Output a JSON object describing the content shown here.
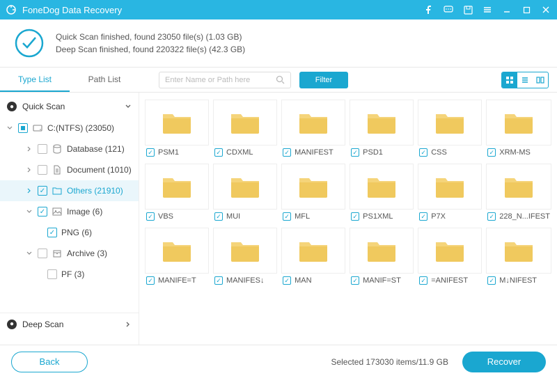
{
  "titlebar": {
    "title": "FoneDog Data Recovery"
  },
  "summary": {
    "line1": "Quick Scan finished, found 23050 file(s) (1.03 GB)",
    "line2": "Deep Scan finished, found 220322 file(s) (42.3 GB)"
  },
  "toolbar": {
    "tab_type": "Type List",
    "tab_path": "Path List",
    "search_placeholder": "Enter Name or Path here",
    "filter_label": "Filter"
  },
  "sidebar": {
    "quick_scan": "Quick Scan",
    "deep_scan": "Deep Scan",
    "drive": "C:(NTFS) (23050)",
    "database": "Database (121)",
    "document": "Document (1010)",
    "others": "Others (21910)",
    "image": "Image (6)",
    "png": "PNG (6)",
    "archive": "Archive (3)",
    "pf": "PF (3)"
  },
  "grid": {
    "items": [
      {
        "name": "PSM1"
      },
      {
        "name": "CDXML"
      },
      {
        "name": "MANIFEST"
      },
      {
        "name": "PSD1"
      },
      {
        "name": "CSS"
      },
      {
        "name": "XRM-MS"
      },
      {
        "name": "VBS"
      },
      {
        "name": "MUI"
      },
      {
        "name": "MFL"
      },
      {
        "name": "PS1XML"
      },
      {
        "name": "P7X"
      },
      {
        "name": "228_N...IFEST"
      },
      {
        "name": "MANIFE=T"
      },
      {
        "name": "MANIFES↓"
      },
      {
        "name": "MAN"
      },
      {
        "name": "MANIF=ST"
      },
      {
        "name": "=ANIFEST"
      },
      {
        "name": "M↓NIFEST"
      }
    ]
  },
  "footer": {
    "back": "Back",
    "status": "Selected 173030 items/11.9 GB",
    "recover": "Recover"
  }
}
